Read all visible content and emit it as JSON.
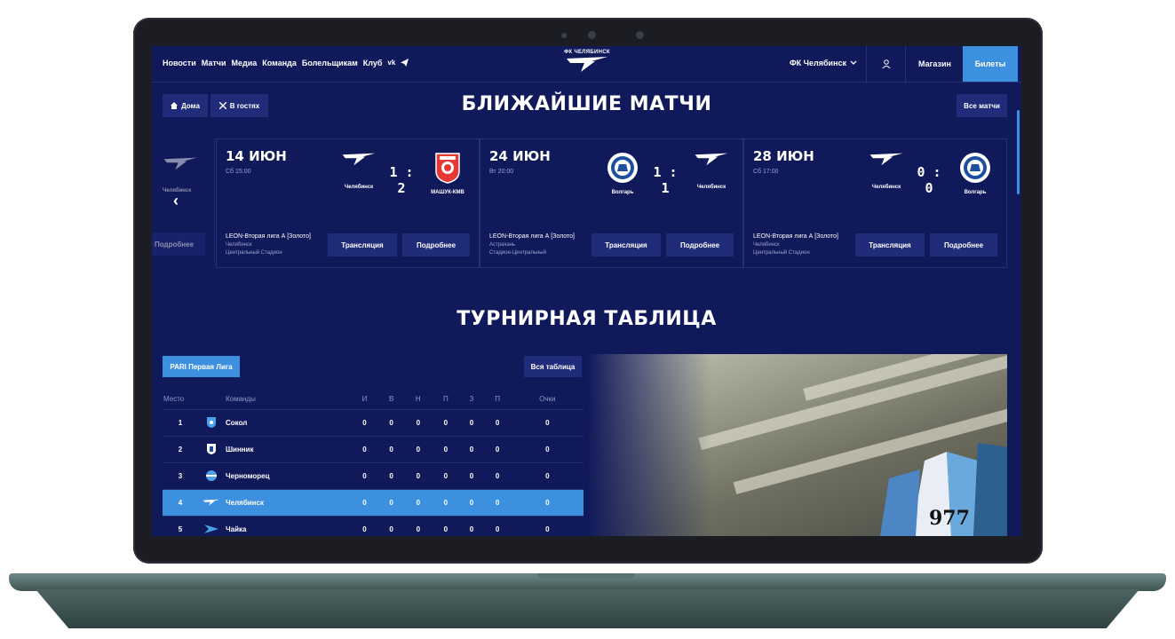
{
  "header": {
    "nav": [
      "Новости",
      "Матчи",
      "Медиа",
      "Команда",
      "Болельщикам",
      "Клуб"
    ],
    "social": [
      "vk-icon",
      "telegram-icon"
    ],
    "logo_text": "ФК ЧЕЛЯБИНСК",
    "club_select": "ФК Челябинск",
    "shop": "Магазин",
    "tickets": "Билеты"
  },
  "matches": {
    "title": "БЛИЖАЙШИЕ МАТЧИ",
    "home_filter": "Дома",
    "away_filter": "В гостях",
    "all_button": "Все матчи",
    "ghost_team": "Челябинск",
    "ghost_more": "Подробнее",
    "cards": [
      {
        "date": "14 ИЮН",
        "time": "Сб 15:00",
        "team_a": "Челябинск",
        "team_b": "МАШУК-КМВ",
        "score": "1 : 2",
        "league": "LEON-Вторая лига А [Золото]",
        "city": "Челябинск",
        "stadium": "Центральный Стадион",
        "broadcast": "Трансляция",
        "more": "Подробнее"
      },
      {
        "date": "24 ИЮН",
        "time": "Вт 20:00",
        "team_a": "Волгарь",
        "team_b": "Челябинск",
        "score": "1 : 1",
        "league": "LEON-Вторая лига А [Золото]",
        "city": "Астрахань",
        "stadium": "Стадион-Центральный",
        "broadcast": "Трансляция",
        "more": "Подробнее"
      },
      {
        "date": "28 ИЮН",
        "time": "Сб 17:00",
        "team_a": "Челябинск",
        "team_b": "Волгарь",
        "score": "0 : 0",
        "league": "LEON-Вторая лига А [Золото]",
        "city": "Челябинск",
        "stadium": "Центральный Стадион",
        "broadcast": "Трансляция",
        "more": "Подробнее"
      }
    ]
  },
  "standings": {
    "title": "ТУРНИРНАЯ ТАБЛИЦА",
    "league_tab": "PARI Первая Лига",
    "all_button": "Вся таблица",
    "columns": [
      "Место",
      "Команды",
      "И",
      "В",
      "Н",
      "П",
      "З",
      "П",
      "Очки"
    ],
    "rows": [
      {
        "place": "1",
        "team": "Сокол",
        "stats": [
          "0",
          "0",
          "0",
          "0",
          "0",
          "0",
          "0"
        ]
      },
      {
        "place": "2",
        "team": "Шинник",
        "stats": [
          "0",
          "0",
          "0",
          "0",
          "0",
          "0",
          "0"
        ]
      },
      {
        "place": "3",
        "team": "Черноморец",
        "stats": [
          "0",
          "0",
          "0",
          "0",
          "0",
          "0",
          "0"
        ]
      },
      {
        "place": "4",
        "team": "Челябинск",
        "stats": [
          "0",
          "0",
          "0",
          "0",
          "0",
          "0",
          "0"
        ]
      },
      {
        "place": "5",
        "team": "Чайка",
        "stats": [
          "0",
          "0",
          "0",
          "0",
          "0",
          "0",
          "0"
        ]
      }
    ],
    "photo_text": "977"
  },
  "colors": {
    "bg": "#10195a",
    "accent": "#3d8fe0",
    "button": "#202b7a"
  }
}
